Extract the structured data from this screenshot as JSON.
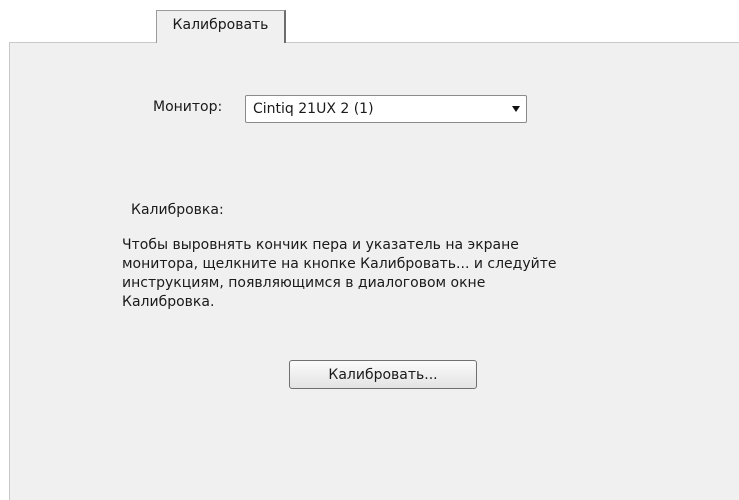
{
  "tabs": [
    {
      "label": "Калибровать",
      "active": true
    }
  ],
  "monitor": {
    "label": "Монитор:",
    "selected": "Cintiq 21UX 2 (1)"
  },
  "calibration": {
    "section_label": "Калибровка:",
    "instructions": "Чтобы выровнять кончик пера и указатель на экране\nмонитора, щелкните на кнопке Калибровать... и следуйте\nинструкциям, появляющимся в диалоговом окне\nКалибровка.",
    "button_label": "Калибровать..."
  },
  "colors": {
    "panel_background": "#f0f0f0",
    "tab_background": "#f0f0f0",
    "page_background": "#ffffff"
  }
}
